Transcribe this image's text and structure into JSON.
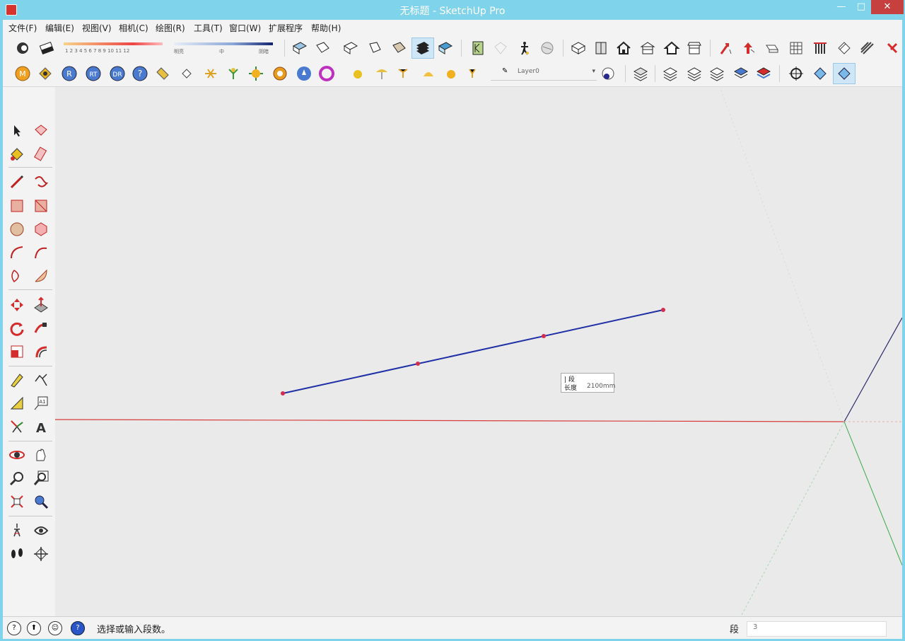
{
  "window": {
    "title": "无标题 - SketchUp Pro",
    "min": "—",
    "max": "□",
    "close": "✕"
  },
  "menu": [
    "文件(F)",
    "编辑(E)",
    "视图(V)",
    "相机(C)",
    "绘图(R)",
    "工具(T)",
    "窗口(W)",
    "扩展程序",
    "帮助(H)"
  ],
  "toolbar1": {
    "scale_ticks": "1 2 3 4 5 6 7 8 9 10 11 12",
    "light_label": "明亮",
    "mid_label": "中",
    "dark_label": "阴暗",
    "icons": [
      "xray-icon",
      "eraser-icon",
      "iso-view-icon",
      "top-view-icon",
      "front-view-icon",
      "right-view-icon",
      "back-view-icon",
      "left-view-icon",
      "section-icon",
      "shadow-icon",
      "person-icon",
      "warehouse-icon",
      "component-icon",
      "box-icon",
      "house-icon",
      "house-tool-icon",
      "house-outline-icon",
      "house-roof-icon",
      "arrow-tool-icon",
      "up-arrow-icon",
      "wall-icon",
      "grid-icon",
      "stair-icon",
      "rail-icon",
      "brush-icon"
    ]
  },
  "toolbar2": {
    "layer_value": "Layer0",
    "icons": [
      "plugin-m-icon",
      "plugin-s-icon",
      "plugin-r-icon",
      "plugin-rt-icon",
      "plugin-dr-icon",
      "help-icon",
      "tag-icon",
      "diamond-icon",
      "spark-icon",
      "plant-icon",
      "sun-icon",
      "ring-icon",
      "drop-icon",
      "circle-icon",
      "dot-icon",
      "umbrella-icon",
      "pin-icon",
      "dome-icon",
      "sphere-icon",
      "pin-small-icon",
      "layers-icon",
      "layer-prev-icon",
      "layer-next-icon",
      "layer-add-icon",
      "layer-delete-icon",
      "layer-color-icon",
      "orbit-icon",
      "camera-icon",
      "walk-icon"
    ]
  },
  "palette": {
    "icons": [
      "select-icon",
      "make-component-icon",
      "paint-bucket-icon",
      "eraser-tool-icon",
      "pencil-icon",
      "freehand-icon",
      "rectangle-icon",
      "rotated-rect-icon",
      "circle-tool-icon",
      "polygon-icon",
      "arc-icon",
      "two-point-arc-icon",
      "three-point-arc-icon",
      "pie-icon",
      "move-icon",
      "push-pull-icon",
      "rotate-icon",
      "follow-me-icon",
      "scale-icon",
      "offset-icon",
      "tape-measure-icon",
      "dimension-icon",
      "protractor-icon",
      "text-tool-icon",
      "axes-icon",
      "3d-text-icon",
      "orbit-tool-icon",
      "pan-icon",
      "zoom-icon",
      "zoom-window-icon",
      "zoom-extents-icon",
      "previous-view-icon",
      "position-camera-icon",
      "look-around-icon",
      "walk-tool-icon",
      "section-plane-icon"
    ]
  },
  "canvas": {
    "tooltip_line1": "| 段",
    "tooltip_line2": "长度",
    "tooltip_value": "2100mm"
  },
  "status": {
    "icons": [
      "info-icon",
      "geo-icon",
      "credits-icon",
      "instructor-icon"
    ],
    "text": "选择或输入段数。",
    "measure_label": "段",
    "measure_value": "3"
  },
  "colors": {
    "title_bg": "#7fd3ea",
    "line": "#1f2fa6",
    "endpoint": "#d42c4e",
    "red_axis": "#d83b3b",
    "green_axis": "#3aa84a",
    "blue_axis": "#2a2a8a"
  }
}
